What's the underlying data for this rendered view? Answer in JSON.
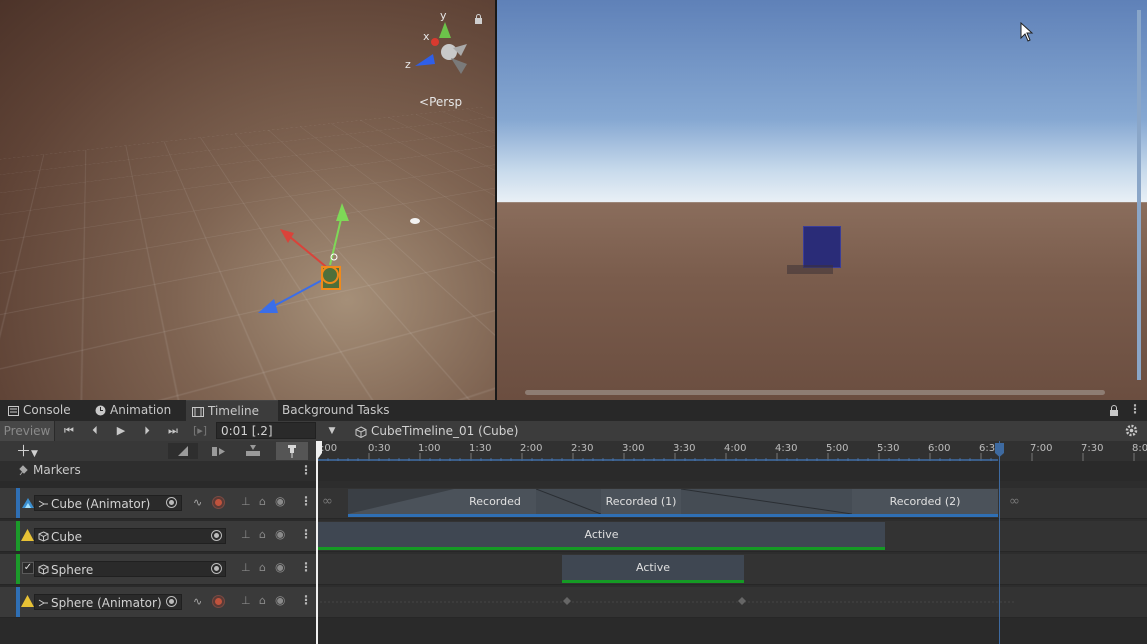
{
  "scene_view": {
    "gizmo_axes": {
      "y": "y",
      "x": "x",
      "z": "z"
    },
    "projection_label": "Persp"
  },
  "tabs": [
    {
      "label": "Console",
      "icon": "console-icon"
    },
    {
      "label": "Animation",
      "icon": "animation-clock-icon"
    },
    {
      "label": "Timeline",
      "icon": "timeline-film-icon",
      "active": true
    },
    {
      "label": "Background Tasks"
    }
  ],
  "toolbar": {
    "preview_label": "Preview",
    "time_value": "0:01 [.2]",
    "asset_label": "CubeTimeline_01 (Cube)"
  },
  "left_panel": {
    "markers_label": "Markers",
    "tracks": [
      {
        "name": "Cube (Animator)",
        "color": "#2f6fb4"
      },
      {
        "name": "Cube",
        "color": "#1b9a2a"
      },
      {
        "name": "Sphere",
        "color": "#1b9a2a"
      },
      {
        "name": "Sphere (Animator)",
        "color": "#2f6fb4"
      }
    ]
  },
  "ruler": {
    "labels": [
      ":00",
      "0:30",
      "1:00",
      "1:30",
      "2:00",
      "2:30",
      "3:00",
      "3:30",
      "4:00",
      "4:30",
      "5:00",
      "5:30",
      "6:00",
      "6:30",
      "7:00",
      "7:30",
      "8:0"
    ]
  },
  "clips": {
    "recorded": [
      "Recorded",
      "Recorded (1)",
      "Recorded (2)"
    ],
    "cube_active": "Active",
    "sphere_active": "Active"
  },
  "colors": {
    "accent": "#3e6aa0",
    "active_green": "#159a24"
  }
}
